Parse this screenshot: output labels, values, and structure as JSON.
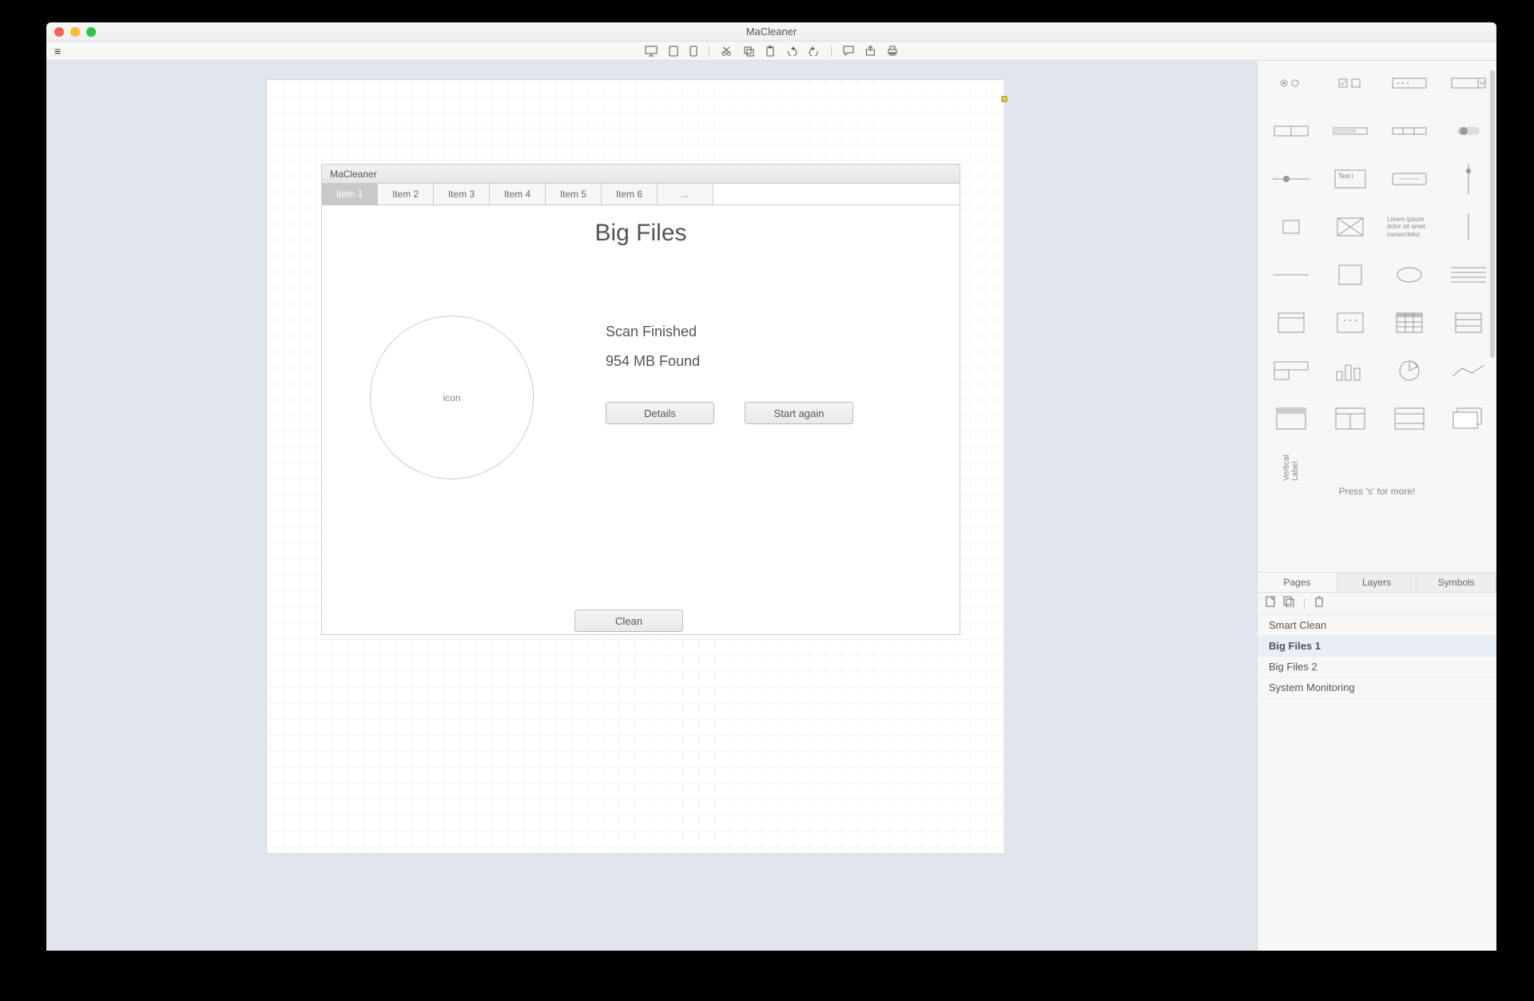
{
  "window": {
    "title": "MaCleaner"
  },
  "mock": {
    "title": "MaCleaner",
    "tabs": [
      "Item 1",
      "Item 2",
      "Item 3",
      "Item 4",
      "Item 5",
      "Item 6",
      "..."
    ],
    "heading": "Big Files",
    "icon_label": "icon",
    "status1": "Scan Finished",
    "status2": "954 MB Found",
    "details_btn": "Details",
    "start_again_btn": "Start again",
    "clean_btn": "Clean"
  },
  "stencil": {
    "hint": "Press 's' for more!",
    "lorem": "Lorem ipsum dolor sit amet consectetur",
    "textinput": "Text i",
    "vlabel": "Vertical Label"
  },
  "right_tabs": [
    "Pages",
    "Layers",
    "Symbols"
  ],
  "pages": [
    "Smart Clean",
    "Big Files 1",
    "Big Files 2",
    "System Monitoring"
  ],
  "active_page_index": 1
}
